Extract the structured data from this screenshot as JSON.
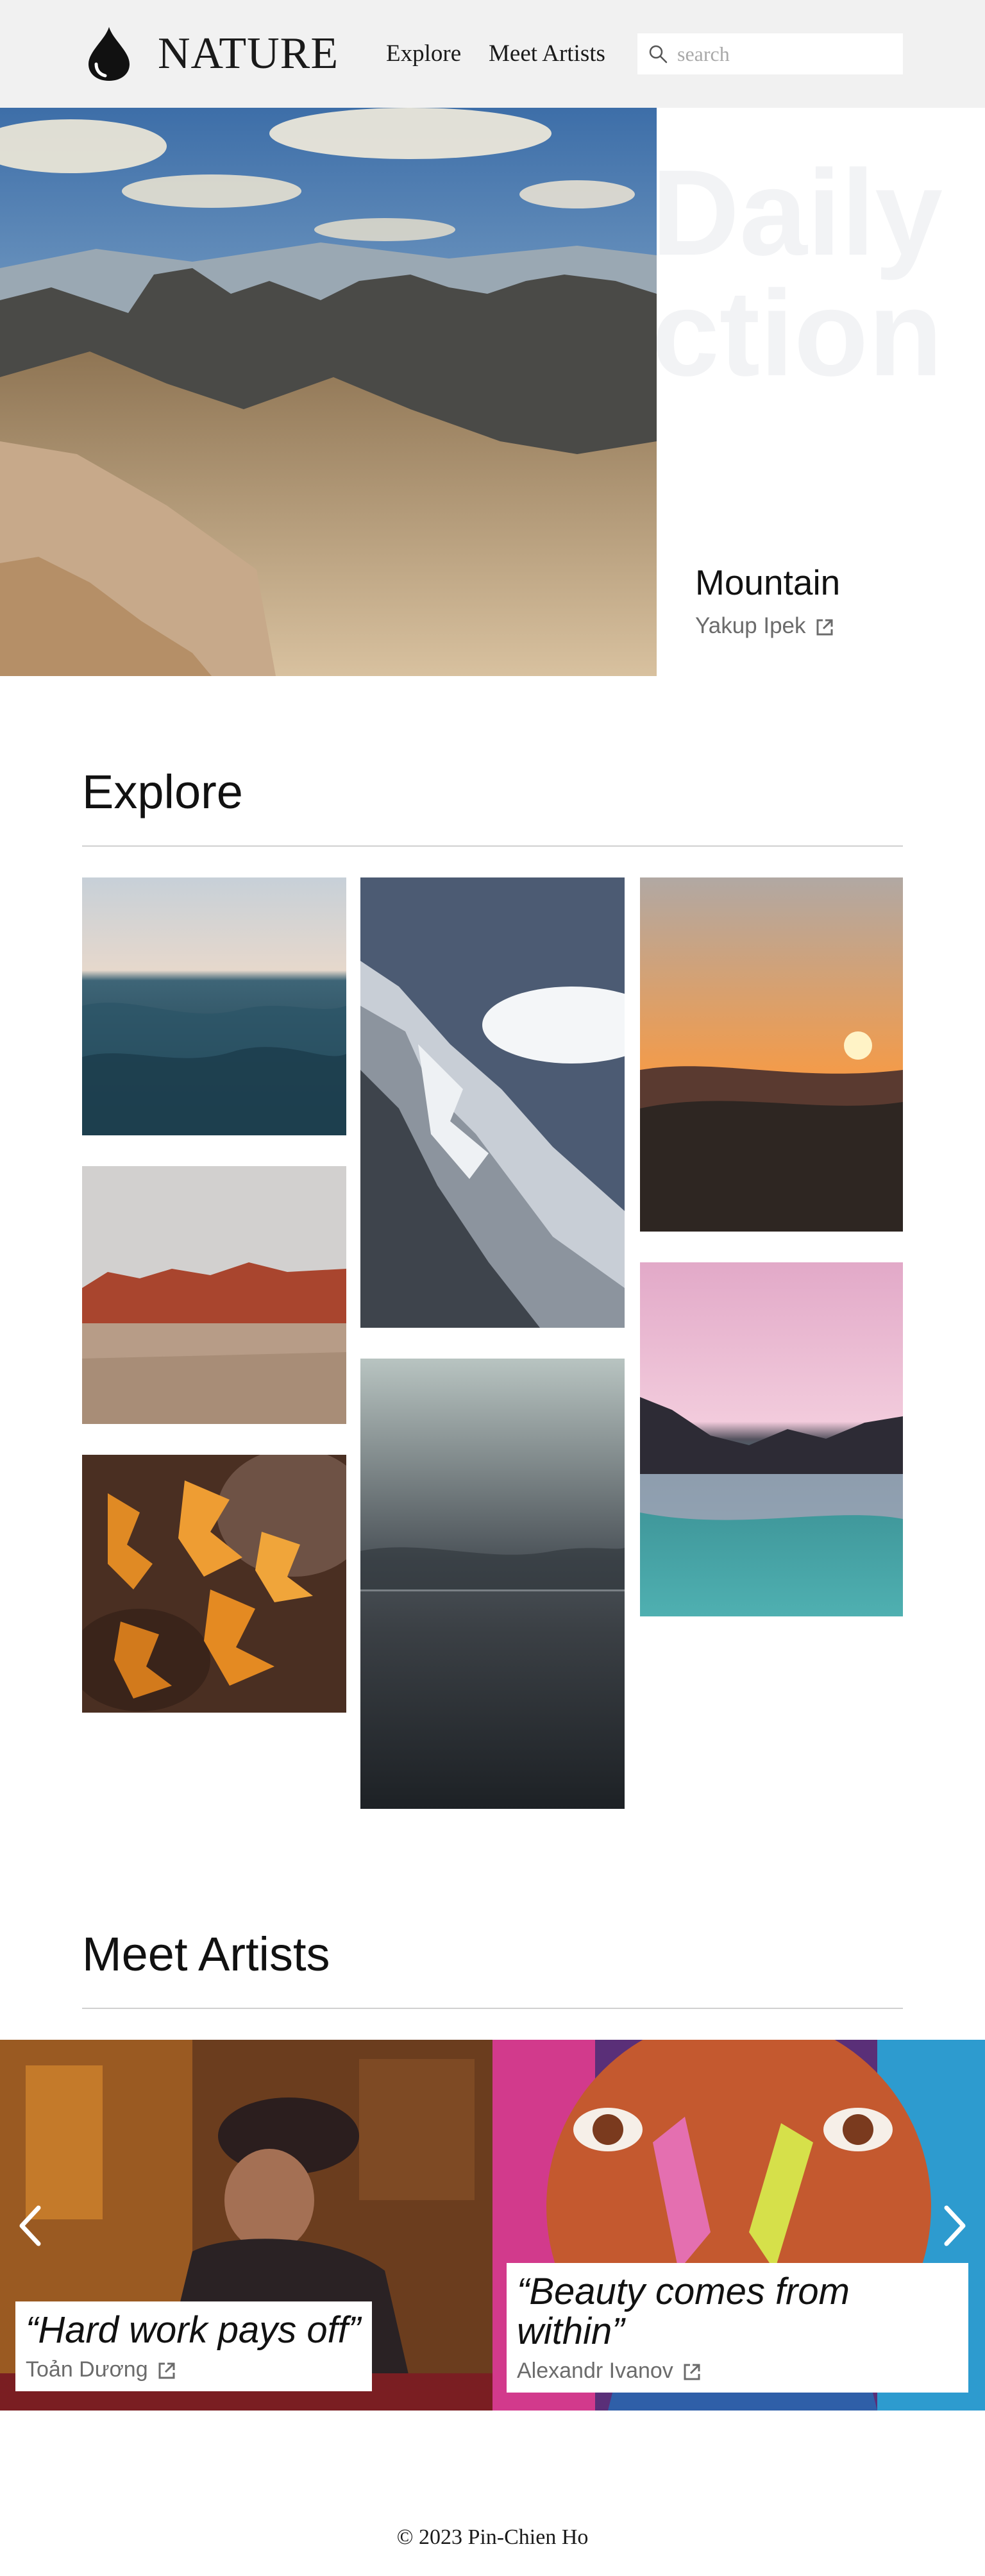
{
  "header": {
    "brand": "NATURE",
    "nav": {
      "explore": "Explore",
      "meet_artists": "Meet Artists"
    },
    "search": {
      "placeholder": "search",
      "value": ""
    }
  },
  "hero": {
    "background_text": [
      "Daily",
      "Selection"
    ],
    "title": "Mountain",
    "author": "Yakup Ipek"
  },
  "explore": {
    "heading": "Explore",
    "photos": [
      "sea-waves",
      "snowy-mountain",
      "sunset-hills",
      "red-rock-desert",
      "stormy-sea",
      "pink-sky-lake",
      "autumn-leaves"
    ]
  },
  "artists": {
    "heading": "Meet Artists",
    "cards": [
      {
        "quote": "“Hard work pays off”",
        "author": "Toản Dương"
      },
      {
        "quote": "“Beauty comes from within”",
        "author": "Alexandr Ivanov"
      }
    ]
  },
  "footer": {
    "text": "© 2023 Pin-Chien Ho"
  },
  "colors": {
    "header_bg": "#f1f1f1",
    "muted_text": "#6b6b6b",
    "rule": "#d0d0d0"
  }
}
